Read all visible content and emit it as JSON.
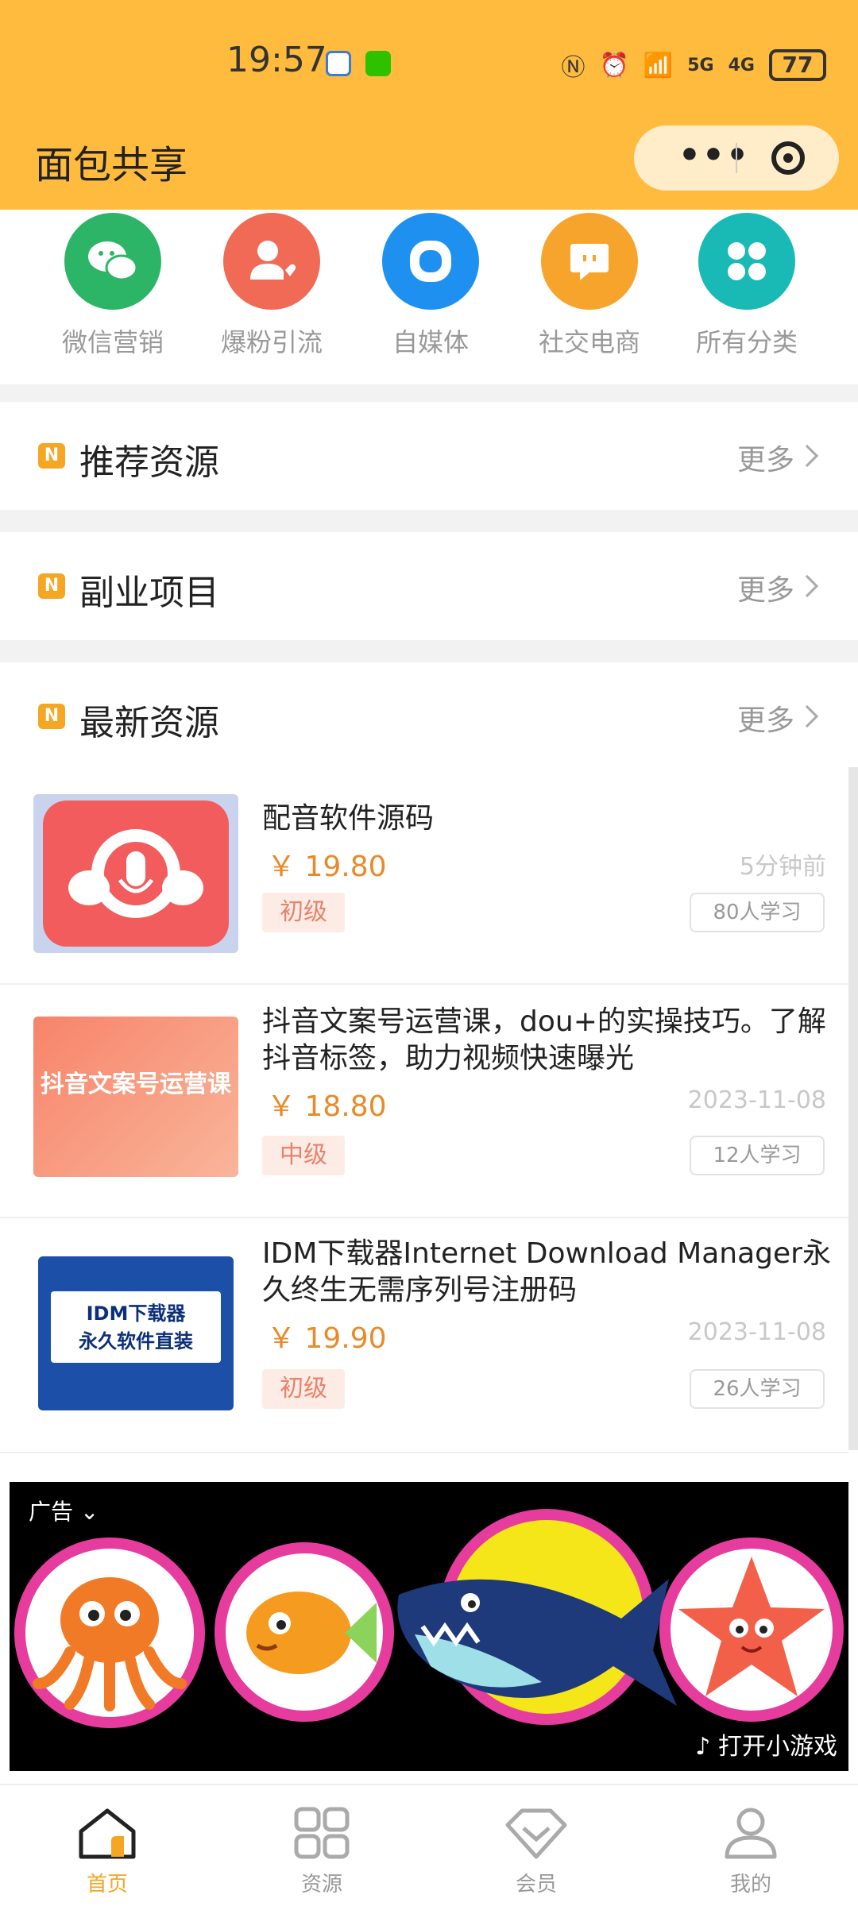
{
  "status": {
    "time": "19:57",
    "battery": "77",
    "net1": "5G",
    "net2": "4G"
  },
  "app": {
    "title": "面包共享",
    "capsule_more": "•••"
  },
  "categories": [
    {
      "label": "微信营销",
      "icon": "wechat-icon",
      "color": "#2DB567"
    },
    {
      "label": "爆粉引流",
      "icon": "user-heart-icon",
      "color": "#F06A55"
    },
    {
      "label": "自媒体",
      "icon": "ring-icon",
      "color": "#1E90F0"
    },
    {
      "label": "社交电商",
      "icon": "chat-bubble-icon",
      "color": "#F7A42C"
    },
    {
      "label": "所有分类",
      "icon": "four-leaf-icon",
      "color": "#19B9B6"
    }
  ],
  "sections": [
    {
      "title": "推荐资源",
      "more": "更多"
    },
    {
      "title": "副业项目",
      "more": "更多"
    },
    {
      "title": "最新资源",
      "more": "更多"
    }
  ],
  "section_mark": "N",
  "items": [
    {
      "title": "配音软件源码",
      "price": "￥ 19.80",
      "time": "5分钟前",
      "level": "初级",
      "learners": "80人学习"
    },
    {
      "title": "抖音文案号运营课，dou+的实操技巧。了解抖音标签，助力视频快速曝光",
      "price": "￥ 18.80",
      "time": "2023-11-08",
      "level": "中级",
      "learners": "12人学习",
      "thumb_text": "抖音文案号运营课"
    },
    {
      "title": "IDM下载器Internet Download Manager永久终生无需序列号注册码",
      "price": "￥ 19.90",
      "time": "2023-11-08",
      "level": "初级",
      "learners": "26人学习",
      "thumb_text": "IDM下载器\n永久软件直装"
    }
  ],
  "ad": {
    "label": "广告",
    "cta": "打开小游戏"
  },
  "nav": [
    {
      "label": "首页",
      "icon": "home-icon",
      "active": true
    },
    {
      "label": "资源",
      "icon": "grid-icon",
      "active": false
    },
    {
      "label": "会员",
      "icon": "diamond-icon",
      "active": false
    },
    {
      "label": "我的",
      "icon": "person-icon",
      "active": false
    }
  ],
  "colors": {
    "accent": "#FFBB3D",
    "price": "#E88A2A",
    "active_tab": "#F5A623"
  }
}
